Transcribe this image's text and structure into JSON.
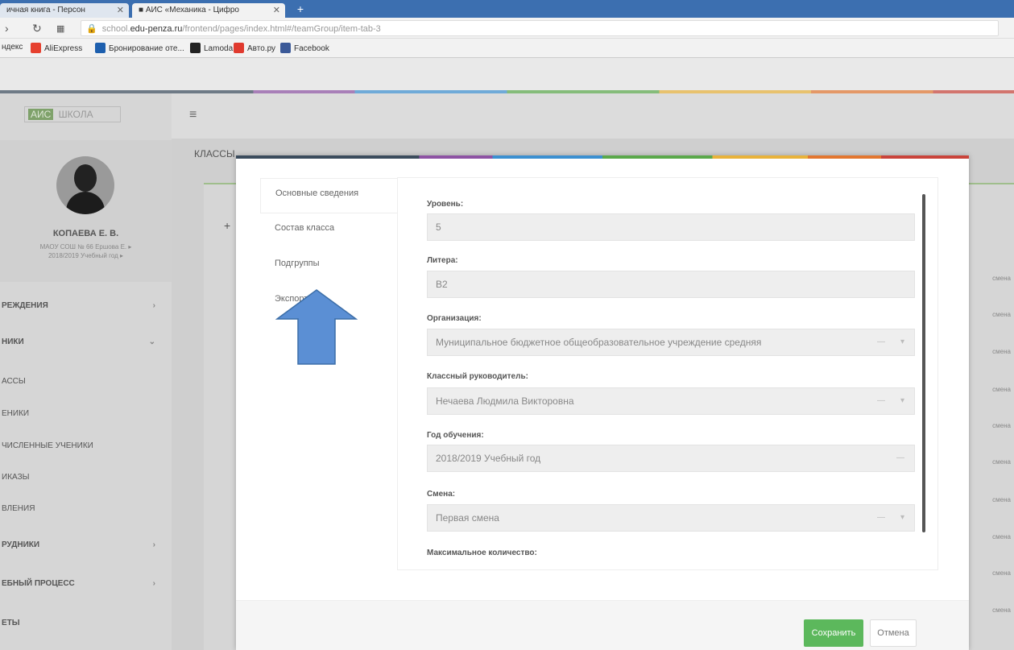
{
  "browser": {
    "tabs": [
      {
        "label": "ичная книга - Персон"
      },
      {
        "label": "АИС «Механика - Цифро"
      }
    ],
    "url_host": "edu-penza.ru",
    "url_prefix": "school.",
    "url_rest": "/frontend/pages/index.html#/teamGroup/item-tab-3",
    "bookmarks": [
      "ндекс",
      "AliExpress",
      "Бронирование оте...",
      "Lamoda",
      "Авто.ру",
      "Facebook"
    ]
  },
  "app": {
    "logo_a": "АИС",
    "logo_b": "ШКОЛА",
    "user_name": "КОПАЕВА Е. В.",
    "user_org": "МАОУ СОШ № 66 Ершова Е. ▸",
    "user_year": "2018/2019 Учебный год ▸",
    "section_title": "КЛАССЫ",
    "menu": [
      {
        "label": "РЕЖДЕНИЯ"
      },
      {
        "label": "НИКИ"
      },
      {
        "label": "АССЫ"
      },
      {
        "label": "ЕНИКИ"
      },
      {
        "label": "ЧИСЛЕННЫЕ УЧЕНИКИ"
      },
      {
        "label": "ИКАЗЫ"
      },
      {
        "label": "ВЛЕНИЯ"
      },
      {
        "label": "РУДНИКИ"
      },
      {
        "label": "ЕБНЫЙ ПРОЦЕСС"
      },
      {
        "label": "ЕТЫ"
      }
    ],
    "row_label": "смена"
  },
  "modal": {
    "tabs": [
      "Основные сведения",
      "Состав класса",
      "Подгруппы",
      "Экспорт"
    ],
    "fields": [
      {
        "label": "Уровень:",
        "value": "5"
      },
      {
        "label": "Литера:",
        "value": "В2"
      },
      {
        "label": "Организация:",
        "value": "Муниципальное бюджетное общеобразовательное учреждение средняя"
      },
      {
        "label": "Классный руководитель:",
        "value": "Нечаева Людмила Викторовна"
      },
      {
        "label": "Год обучения:",
        "value": "2018/2019 Учебный год"
      },
      {
        "label": "Смена:",
        "value": "Первая смена"
      },
      {
        "label": "Максимальное количество:",
        "value": ""
      }
    ],
    "save": "Сохранить",
    "cancel": "Отмена"
  },
  "colors": {
    "arrow": "#5b8fd4",
    "save": "#5cb85c"
  }
}
